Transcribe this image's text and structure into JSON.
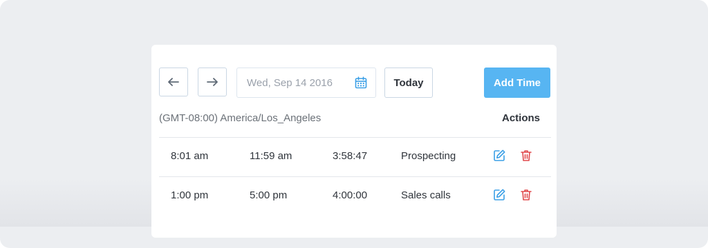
{
  "toolbar": {
    "prev_icon": "arrow-left-icon",
    "next_icon": "arrow-right-icon",
    "date_value": "Wed, Sep 14 2016",
    "calendar_icon": "calendar-icon",
    "today_label": "Today",
    "add_time_label": "Add Time"
  },
  "timezone": "(GMT-08:00) America/Los_Angeles",
  "actions_header": "Actions",
  "entries": [
    {
      "start": "8:01 am",
      "end": "11:59 am",
      "duration": "3:58:47",
      "activity": "Prospecting"
    },
    {
      "start": "1:00 pm",
      "end": "5:00 pm",
      "duration": "4:00:00",
      "activity": "Sales calls"
    }
  ],
  "colors": {
    "accent": "#57b5f2",
    "edit": "#3a9fe6",
    "delete": "#e0484b",
    "text": "#2f343b",
    "muted": "#9aa1ab"
  }
}
